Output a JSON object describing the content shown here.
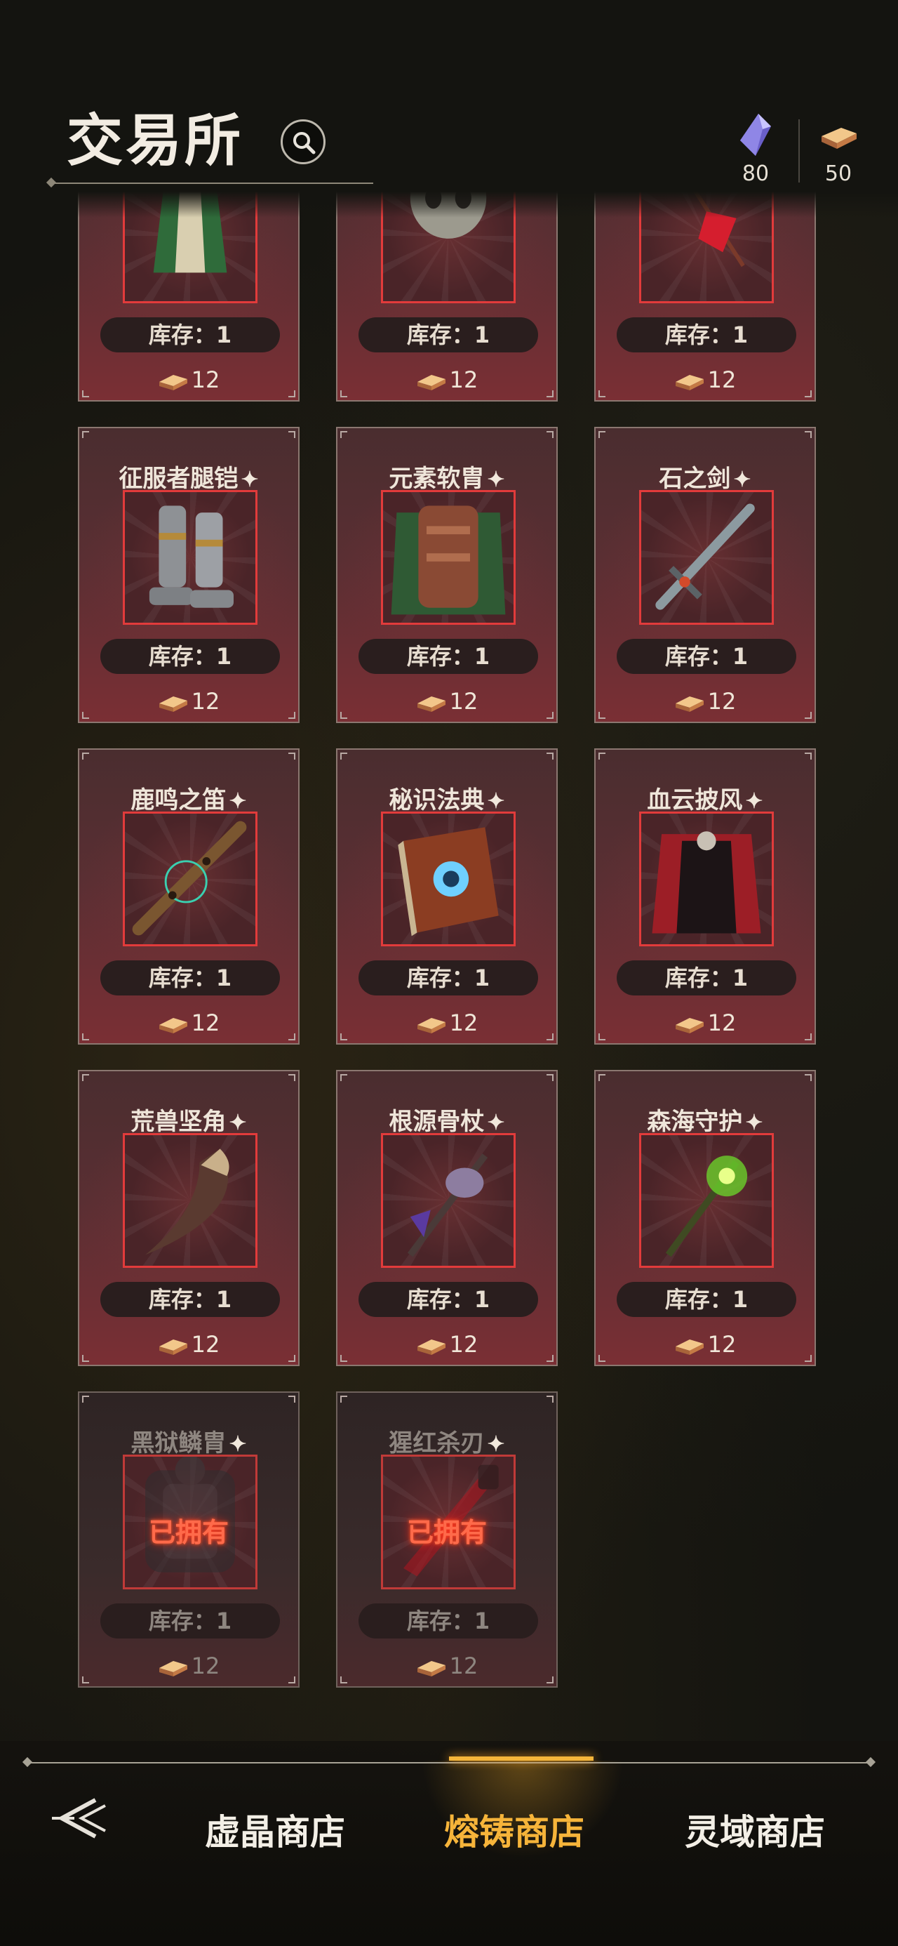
{
  "header": {
    "title": "交易所"
  },
  "currency": [
    {
      "icon": "crystal-icon",
      "amount": "80"
    },
    {
      "icon": "ingot-icon",
      "amount": "50"
    }
  ],
  "stock_label": "库存：1",
  "price": "12",
  "owned_label": "已拥有",
  "items": [
    {
      "name": "",
      "icon": "green-robe-icon",
      "owned": false
    },
    {
      "name": "",
      "icon": "skull-mask-icon",
      "owned": false
    },
    {
      "name": "",
      "icon": "red-staff-icon",
      "owned": false
    },
    {
      "name": "征服者腿铠",
      "icon": "greaves-icon",
      "owned": false
    },
    {
      "name": "元素软胄",
      "icon": "armor-cloak-icon",
      "owned": false
    },
    {
      "name": "石之剑",
      "icon": "sword-icon",
      "owned": false
    },
    {
      "name": "鹿鸣之笛",
      "icon": "flute-icon",
      "owned": false
    },
    {
      "name": "秘识法典",
      "icon": "tome-icon",
      "owned": false
    },
    {
      "name": "血云披风",
      "icon": "cape-icon",
      "owned": false
    },
    {
      "name": "荒兽坚角",
      "icon": "horn-icon",
      "owned": false
    },
    {
      "name": "根源骨杖",
      "icon": "bone-staff-icon",
      "owned": false
    },
    {
      "name": "森海守护",
      "icon": "forest-staff-icon",
      "owned": false
    },
    {
      "name": "黑狱鳞胄",
      "icon": "dark-armor-icon",
      "owned": true
    },
    {
      "name": "猩红杀刃",
      "icon": "crimson-blade-icon",
      "owned": true
    }
  ],
  "nav": {
    "tabs": [
      {
        "label": "虚晶商店",
        "active": false
      },
      {
        "label": "熔铸商店",
        "active": true
      },
      {
        "label": "灵域商店",
        "active": false
      }
    ]
  },
  "colors": {
    "accent": "#f6b43a",
    "frame": "#e23b3b",
    "owned": "#ff6a4a"
  }
}
